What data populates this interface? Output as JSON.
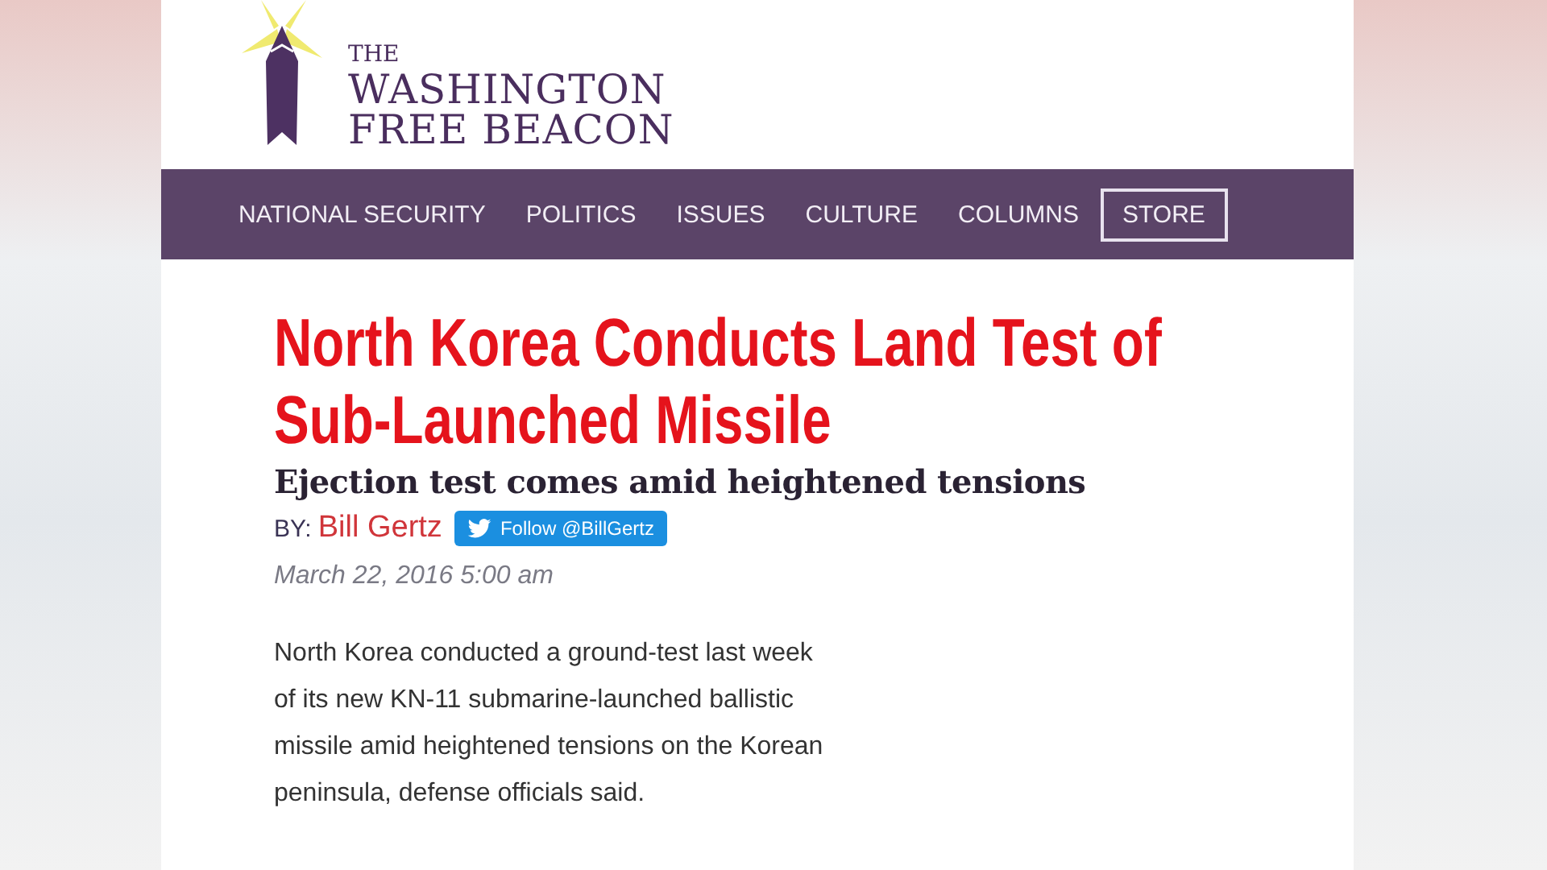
{
  "logo": {
    "lines": [
      "THE",
      "WASHINGTON",
      "FREE BEACON"
    ]
  },
  "nav": [
    {
      "label": "NATIONAL SECURITY",
      "kind": "link"
    },
    {
      "label": "POLITICS",
      "kind": "link"
    },
    {
      "label": "ISSUES",
      "kind": "link"
    },
    {
      "label": "CULTURE",
      "kind": "link"
    },
    {
      "label": "COLUMNS",
      "kind": "link"
    },
    {
      "label": "STORE",
      "kind": "boxed"
    }
  ],
  "article": {
    "headline": "North Korea Conducts Land Test of Sub-Launched Missile",
    "subheadline": "Ejection test comes amid heightened tensions",
    "byline_prefix": "BY:",
    "author": "Bill Gertz",
    "follow_button": "Follow @BillGertz",
    "date": "March 22, 2016 5:00 am",
    "body": "North Korea conducted a ground-test last week of its new KN-11 submarine-launched ballistic missile amid heightened tensions on the Korean peninsula, defense officials said."
  }
}
